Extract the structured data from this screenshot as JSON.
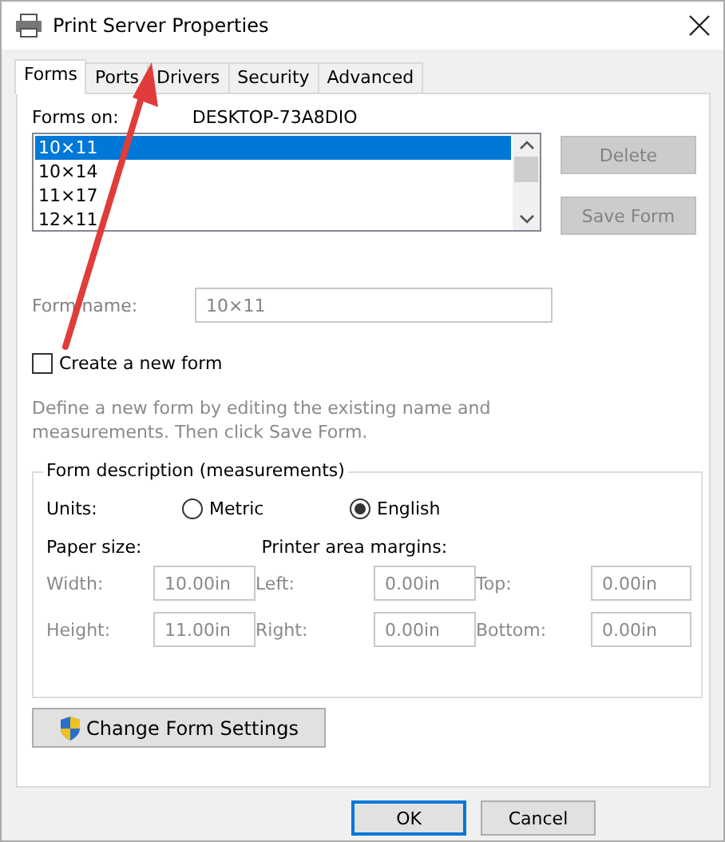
{
  "window": {
    "title": "Print Server Properties"
  },
  "tabs": [
    {
      "label": "Forms",
      "selected": true
    },
    {
      "label": "Ports",
      "selected": false
    },
    {
      "label": "Drivers",
      "selected": false
    },
    {
      "label": "Security",
      "selected": false
    },
    {
      "label": "Advanced",
      "selected": false
    }
  ],
  "forms_on": {
    "label": "Forms on:",
    "value": "DESKTOP-73A8DIO"
  },
  "forms_list": [
    {
      "label": "10×11",
      "selected": true
    },
    {
      "label": "10×14",
      "selected": false
    },
    {
      "label": "11×17",
      "selected": false
    },
    {
      "label": "12×11",
      "selected": false
    }
  ],
  "side_buttons": [
    {
      "label": "Delete",
      "disabled": true
    },
    {
      "label": "Save Form",
      "disabled": true
    }
  ],
  "form_name": {
    "label": "Form name:",
    "value": "10×11",
    "disabled": true
  },
  "create_new_form": {
    "label": "Create a new form",
    "checked": false
  },
  "hint": "Define a new form by editing the existing name and measurements. Then click Save Form.",
  "form_description": {
    "title": "Form description (measurements)",
    "units_label": "Units:",
    "units": [
      {
        "label": "Metric",
        "selected": false
      },
      {
        "label": "English",
        "selected": true
      }
    ],
    "paper_size": {
      "heading": "Paper size:",
      "fields": [
        {
          "label": "Width:",
          "value": "10.00in",
          "disabled": true
        },
        {
          "label": "Height:",
          "value": "11.00in",
          "disabled": true
        }
      ]
    },
    "margins": {
      "heading": "Printer area margins:",
      "fields": [
        {
          "label": "Left:",
          "value": "0.00in",
          "disabled": true
        },
        {
          "label": "Top:",
          "value": "0.00in",
          "disabled": true
        },
        {
          "label": "Right:",
          "value": "0.00in",
          "disabled": true
        },
        {
          "label": "Bottom:",
          "value": "0.00in",
          "disabled": true
        }
      ]
    }
  },
  "change_settings_button": "Change Form Settings",
  "dialog_buttons": [
    {
      "label": "OK",
      "default": true
    },
    {
      "label": "Cancel",
      "default": false
    }
  ]
}
